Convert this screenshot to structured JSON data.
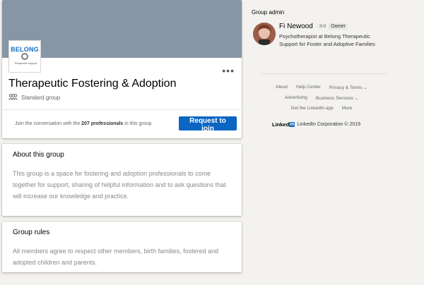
{
  "group": {
    "logo_brand": "BELONG",
    "logo_tagline": "Therapeutic Support",
    "more_label": "•••",
    "title": "Therapeutic Fostering & Adoption",
    "type": "Standard group",
    "join_prefix": "Join the conversation with the ",
    "join_count": "207 professionals",
    "join_suffix": " in this group",
    "join_button": "Request to join"
  },
  "about": {
    "title": "About this group",
    "body": "This group is a space for fostering and adoption professionals to come together for support, sharing of helpful information and to ask questions that will increase our knowledge and practice."
  },
  "rules": {
    "title": "Group rules",
    "body": "All members agree to respect other members, birth families, fostered and adopted children and parents."
  },
  "admin": {
    "heading": "Group admin",
    "name": "Fi Newood",
    "degree": "· 3rd",
    "badge": "Owner",
    "title": "Psychotherapist at Belong Therapeutic Support for Foster and Adoptive Families"
  },
  "footer": {
    "row1": [
      "About",
      "Help Center",
      "Privacy & Terms ⌄"
    ],
    "row2": [
      "Advertising",
      "Business Services ⌄"
    ],
    "row3": [
      "Get the LinkedIn app",
      "More"
    ],
    "brand_linked": "Linked",
    "brand_in": "in",
    "copyright": "LinkedIn Corporation © 2019"
  }
}
